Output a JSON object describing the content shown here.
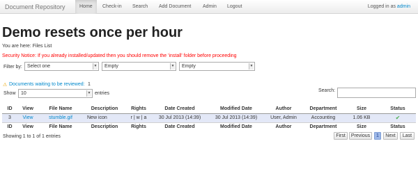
{
  "navbar": {
    "brand": "Document Repository",
    "items": [
      {
        "label": "Home",
        "active": true
      },
      {
        "label": "Check-in",
        "active": false
      },
      {
        "label": "Search",
        "active": false
      },
      {
        "label": "Add Document",
        "active": false
      },
      {
        "label": "Admin",
        "active": false
      },
      {
        "label": "Logout",
        "active": false
      }
    ],
    "login_prefix": "Logged in as",
    "login_user": "admin"
  },
  "page": {
    "title": "Demo resets once per hour",
    "breadcrumb": "You are here: Files List",
    "security_notice": "Security Notice: If you already installed/updated then you should remove the 'install' folder before proceeding"
  },
  "filter": {
    "label": "Filter by:",
    "selects": [
      "Select one",
      "Empty",
      "Empty"
    ]
  },
  "pending": {
    "link_text": "Documents waiting to be reviewed:",
    "count": "1",
    "icon": "warning-icon"
  },
  "table_controls": {
    "show_label": "Show",
    "page_size": "10",
    "entries_label": "entries",
    "search_label": "Search:",
    "search_value": ""
  },
  "table": {
    "columns": [
      "ID",
      "View",
      "File Name",
      "Description",
      "Rights",
      "Date Created",
      "Modified Date",
      "Author",
      "Department",
      "Size",
      "Status"
    ],
    "rows": [
      {
        "id": "3",
        "view": "View",
        "file_name": "stumble.gif",
        "description": "New icon",
        "rights": "r | w | a",
        "date_created": "30 Jul 2013 (14:39)",
        "modified_date": "30 Jul 2013 (14:39)",
        "author": "User, Admin",
        "department": "Accounting",
        "size": "1.06 KB",
        "status_icon": "checkmark-icon"
      }
    ]
  },
  "footer": {
    "showing": "Showing 1 to 1 of 1 entries",
    "pager": [
      "First",
      "Previous",
      "1",
      "Next",
      "Last"
    ]
  },
  "colors": {
    "link": "#0088cc",
    "notice": "#ff0000",
    "row_bg": "#e3e8f7",
    "current_page": "#9fb9e8"
  }
}
